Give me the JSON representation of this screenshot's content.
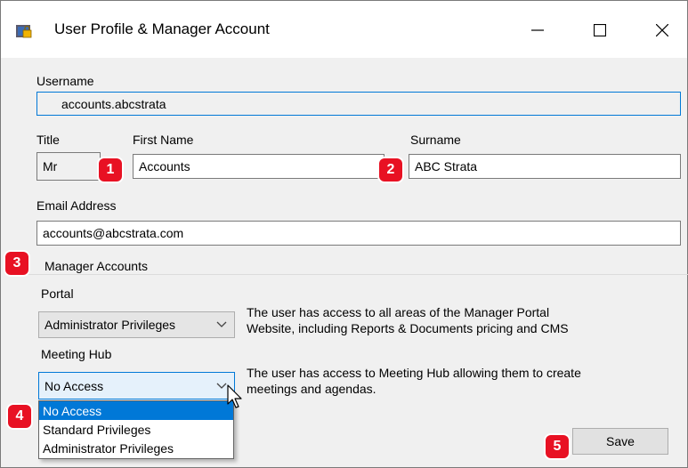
{
  "window": {
    "title": "User Profile & Manager Account",
    "icon": "app-lock-icon",
    "controls": [
      "minimize-icon",
      "maximize-icon",
      "close-icon"
    ]
  },
  "username": {
    "label": "Username",
    "value": "accounts.abcstrata"
  },
  "title_field": {
    "label": "Title",
    "value": "Mr"
  },
  "first_name": {
    "label": "First Name",
    "value": "Accounts"
  },
  "surname": {
    "label": "Surname",
    "value": "ABC Strata"
  },
  "email": {
    "label": "Email Address",
    "value": "accounts@abcstrata.com"
  },
  "manager_accounts": {
    "group_label": "Manager Accounts",
    "portal": {
      "label": "Portal",
      "selected": "Administrator Privileges",
      "description_line1": "The user has access to all areas of the Manager Portal",
      "description_line2": "Website, including Reports & Documents pricing and CMS"
    },
    "meeting_hub": {
      "label": "Meeting Hub",
      "selected": "No Access",
      "description_line1": "The user has access to Meeting Hub allowing them to create",
      "description_line2": "meetings and agendas.",
      "options": [
        "No Access",
        "Standard Privileges",
        "Administrator Privileges"
      ]
    }
  },
  "save_label": "Save",
  "badges": [
    "1",
    "2",
    "3",
    "4",
    "5"
  ],
  "colors": {
    "badge": "#e81123",
    "accent": "#0078d7"
  }
}
